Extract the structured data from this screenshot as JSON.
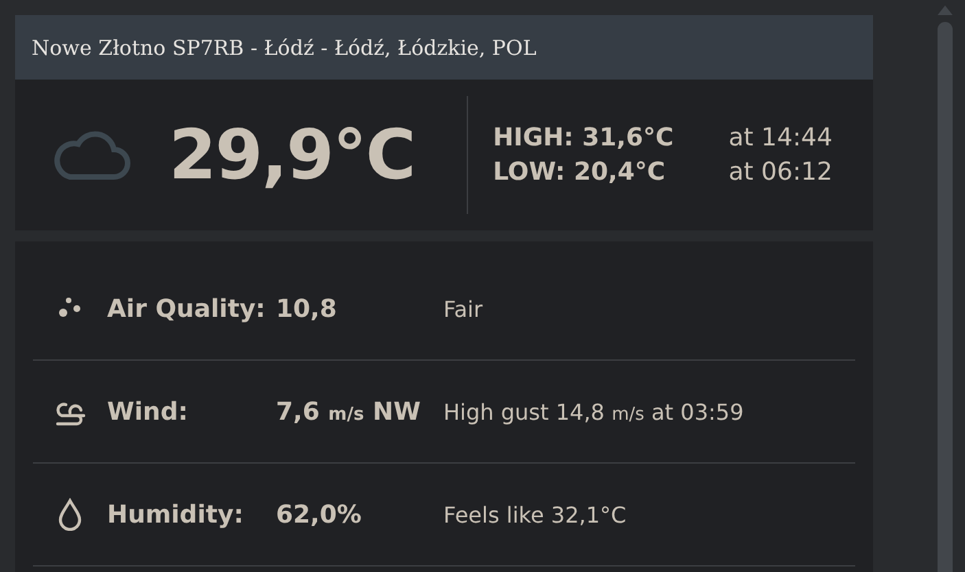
{
  "station": {
    "title": "Nowe Złotno SP7RB - Łódź - Łódź, Łódzkie, POL"
  },
  "current": {
    "kind": "cloud",
    "temperature": "29,9°C",
    "high": {
      "label": "HIGH: 31,6°C",
      "time": "at 14:44"
    },
    "low": {
      "label": "LOW: 20,4°C",
      "time": "at 06:12"
    }
  },
  "rows": [
    {
      "kind": "air",
      "label": "Air Quality:",
      "value": [
        {
          "kind": "text",
          "text": "10,8"
        }
      ],
      "detail": [
        {
          "kind": "text",
          "text": "Fair"
        }
      ]
    },
    {
      "kind": "wind",
      "label": "Wind:",
      "value": [
        {
          "kind": "text",
          "text": "7,6"
        },
        {
          "kind": "unit",
          "text": "m/s"
        },
        {
          "kind": "text",
          "text": "NW"
        }
      ],
      "detail": [
        {
          "kind": "text",
          "text": "High gust 14,8"
        },
        {
          "kind": "unit",
          "text": "m/s"
        },
        {
          "kind": "text",
          "text": "at 03:59"
        }
      ]
    },
    {
      "kind": "humidity",
      "label": "Humidity:",
      "value": [
        {
          "kind": "text",
          "text": "62,0%"
        }
      ],
      "detail": [
        {
          "kind": "text",
          "text": "Feels like 32,1°C"
        }
      ]
    }
  ]
}
